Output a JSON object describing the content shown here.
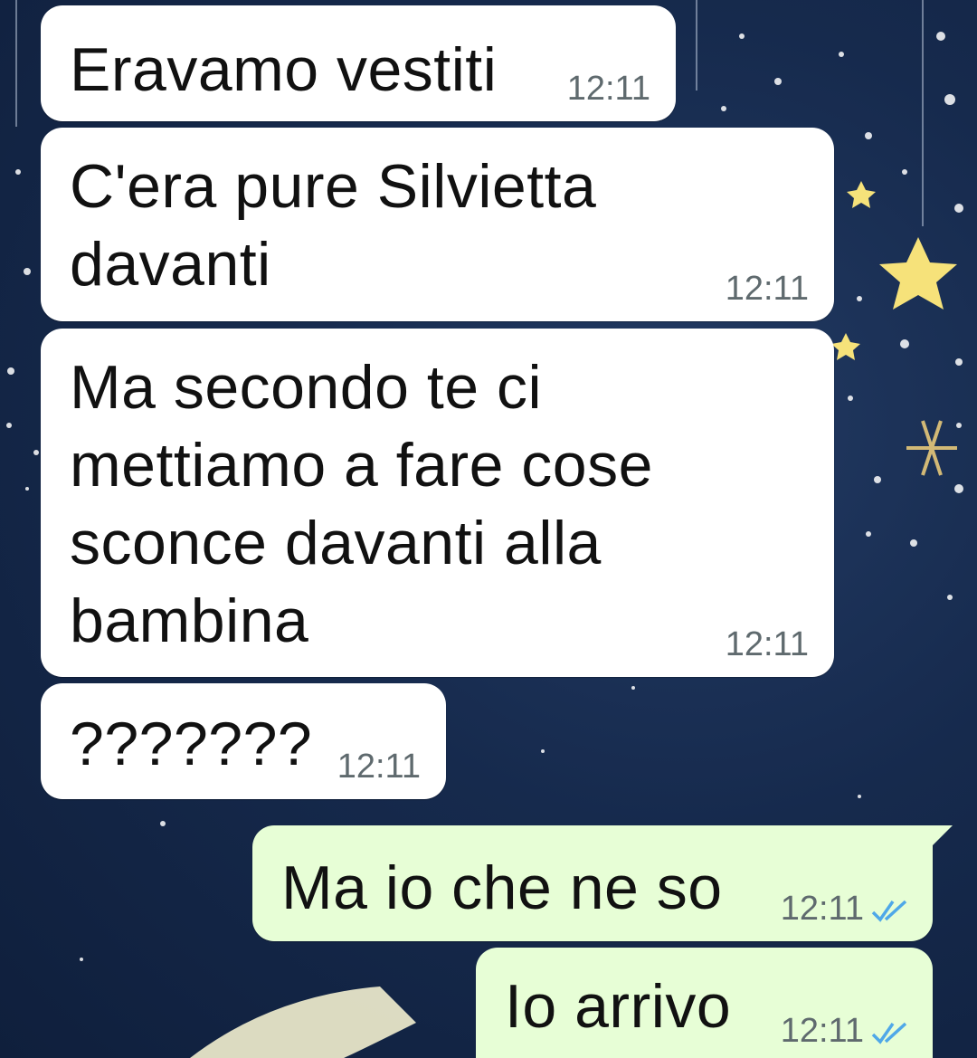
{
  "chat": {
    "messages": [
      {
        "direction": "incoming",
        "text": "Eravamo vestiti",
        "time": "12:11"
      },
      {
        "direction": "incoming",
        "text": "C'era pure Silvietta\ndavanti",
        "time": "12:11"
      },
      {
        "direction": "incoming",
        "text": "Ma secondo te ci\nmettiamo a fare cose\nsconce davanti alla\nbambina",
        "time": "12:11"
      },
      {
        "direction": "incoming",
        "text": "???????",
        "time": "12:11"
      },
      {
        "direction": "outgoing",
        "text": "Ma io che ne so",
        "time": "12:11",
        "status_icon": "double-check-read-icon"
      },
      {
        "direction": "outgoing",
        "text": "Io arrivo",
        "time": "12:11",
        "status_icon": "double-check-read-icon"
      }
    ]
  },
  "colors": {
    "incoming_bubble": "#ffffff",
    "outgoing_bubble": "#e7fed6",
    "read_ticks": "#4fa8e8",
    "wallpaper": "#162a4d"
  },
  "wallpaper": {
    "theme": "night-sky-stars-icon"
  }
}
